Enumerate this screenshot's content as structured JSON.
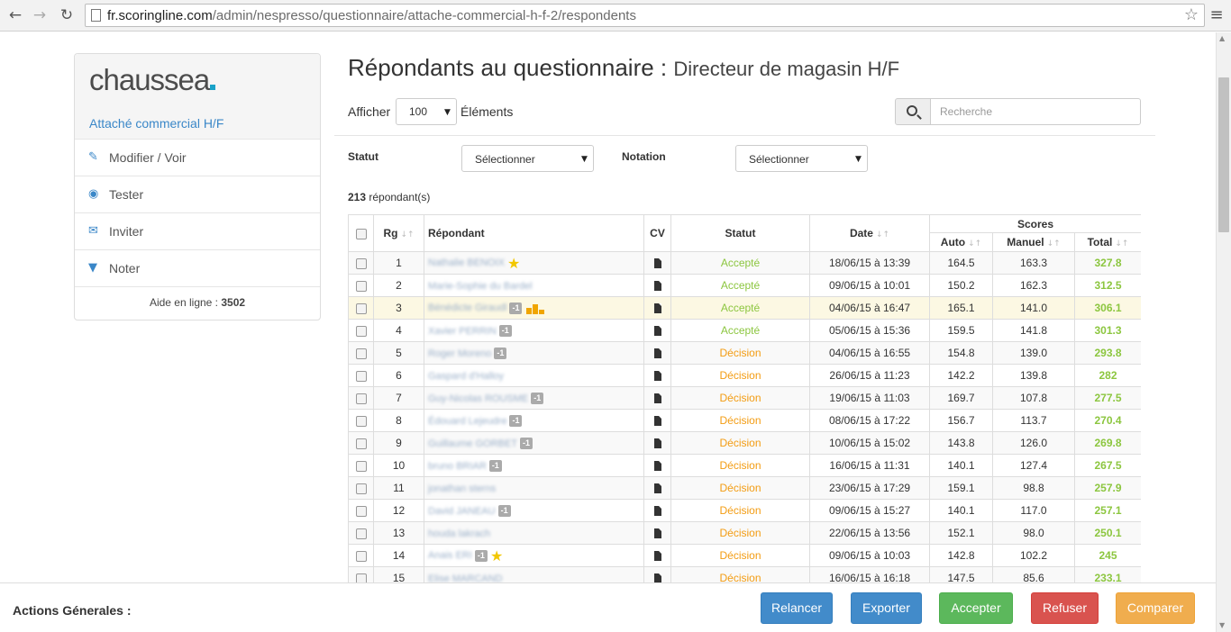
{
  "browser": {
    "url_host": "fr.scoringline.com",
    "url_path": "/admin/nespresso/questionnaire/attache-commercial-h-f-2/respondents"
  },
  "sidebar": {
    "logo": "chaussea",
    "subtitle": "Attaché commercial H/F",
    "items": [
      {
        "label": "Modifier / Voir",
        "icon": "edit-icon"
      },
      {
        "label": "Tester",
        "icon": "eye-icon"
      },
      {
        "label": "Inviter",
        "icon": "envelope-icon"
      },
      {
        "label": "Noter",
        "icon": "filter-icon"
      }
    ],
    "help_label": "Aide en ligne : ",
    "help_number": "3502"
  },
  "main": {
    "title": "Répondants au questionnaire : ",
    "title_sub": "Directeur de magasin H/F",
    "show_label": "Afficher",
    "show_value": "100",
    "elements_label": "Éléments",
    "search_placeholder": "Recherche",
    "statut_label": "Statut",
    "statut_value": "Sélectionner",
    "notation_label": "Notation",
    "notation_value": "Sélectionner",
    "count_number": "213",
    "count_label": " répondant(s)"
  },
  "table": {
    "headers": {
      "rank": "Rg",
      "respondent": "Répondant",
      "cv": "CV",
      "status": "Statut",
      "date": "Date",
      "scores": "Scores",
      "auto": "Auto",
      "manual": "Manuel",
      "total": "Total"
    },
    "rows": [
      {
        "rank": "1",
        "name": "Nathalie BENOIX",
        "badge": "",
        "icon": "star",
        "status": "Accepté",
        "date": "18/06/15 à 13:39",
        "auto": "164.5",
        "manual": "163.3",
        "total": "327.8"
      },
      {
        "rank": "2",
        "name": "Marie-Sophie du Bardel",
        "badge": "",
        "icon": "",
        "status": "Accepté",
        "date": "09/06/15 à 10:01",
        "auto": "150.2",
        "manual": "162.3",
        "total": "312.5"
      },
      {
        "rank": "3",
        "name": "Bénédicte Giraudl",
        "badge": "-1",
        "icon": "podium",
        "status": "Accepté",
        "date": "04/06/15 à 16:47",
        "auto": "165.1",
        "manual": "141.0",
        "total": "306.1"
      },
      {
        "rank": "4",
        "name": "Xavier PERRIN",
        "badge": "-1",
        "icon": "",
        "status": "Accepté",
        "date": "05/06/15 à 15:36",
        "auto": "159.5",
        "manual": "141.8",
        "total": "301.3"
      },
      {
        "rank": "5",
        "name": "Roger Moreno",
        "badge": "-1",
        "icon": "",
        "status": "Décision",
        "date": "04/06/15 à 16:55",
        "auto": "154.8",
        "manual": "139.0",
        "total": "293.8"
      },
      {
        "rank": "6",
        "name": "Gaspard d'Halloy",
        "badge": "",
        "icon": "",
        "status": "Décision",
        "date": "26/06/15 à 11:23",
        "auto": "142.2",
        "manual": "139.8",
        "total": "282"
      },
      {
        "rank": "7",
        "name": "Guy-Nicolas ROUSME",
        "badge": "-1",
        "icon": "",
        "status": "Décision",
        "date": "19/06/15 à 11:03",
        "auto": "169.7",
        "manual": "107.8",
        "total": "277.5"
      },
      {
        "rank": "8",
        "name": "Édouard Lejeudre",
        "badge": "-1",
        "icon": "",
        "status": "Décision",
        "date": "08/06/15 à 17:22",
        "auto": "156.7",
        "manual": "113.7",
        "total": "270.4"
      },
      {
        "rank": "9",
        "name": "Guillaume GORBET",
        "badge": "-1",
        "icon": "",
        "status": "Décision",
        "date": "10/06/15 à 15:02",
        "auto": "143.8",
        "manual": "126.0",
        "total": "269.8"
      },
      {
        "rank": "10",
        "name": "bruno BRIAR",
        "badge": "-1",
        "icon": "",
        "status": "Décision",
        "date": "16/06/15 à 11:31",
        "auto": "140.1",
        "manual": "127.4",
        "total": "267.5"
      },
      {
        "rank": "11",
        "name": "jonathan sterns",
        "badge": "",
        "icon": "",
        "status": "Décision",
        "date": "23/06/15 à 17:29",
        "auto": "159.1",
        "manual": "98.8",
        "total": "257.9"
      },
      {
        "rank": "12",
        "name": "David JANEAU",
        "badge": "-1",
        "icon": "",
        "status": "Décision",
        "date": "09/06/15 à 15:27",
        "auto": "140.1",
        "manual": "117.0",
        "total": "257.1"
      },
      {
        "rank": "13",
        "name": "houda lakrach",
        "badge": "",
        "icon": "",
        "status": "Décision",
        "date": "22/06/15 à 13:56",
        "auto": "152.1",
        "manual": "98.0",
        "total": "250.1"
      },
      {
        "rank": "14",
        "name": "Anais ERI",
        "badge": "-1",
        "icon": "star",
        "status": "Décision",
        "date": "09/06/15 à 10:03",
        "auto": "142.8",
        "manual": "102.2",
        "total": "245"
      },
      {
        "rank": "15",
        "name": "Elise MARCAND",
        "badge": "",
        "icon": "",
        "status": "Décision",
        "date": "16/06/15 à 16:18",
        "auto": "147.5",
        "manual": "85.6",
        "total": "233.1"
      }
    ]
  },
  "footer": {
    "label": "Actions Génerales :",
    "buttons": {
      "relancer": "Relancer",
      "exporter": "Exporter",
      "accepter": "Accepter",
      "refuser": "Refuser",
      "comparer": "Comparer"
    }
  },
  "colors": {
    "accent_blue": "#428bca",
    "accepted_green": "#8cc63f",
    "decision_orange": "#f39c12",
    "highlight_row": "#fcf8e3"
  }
}
